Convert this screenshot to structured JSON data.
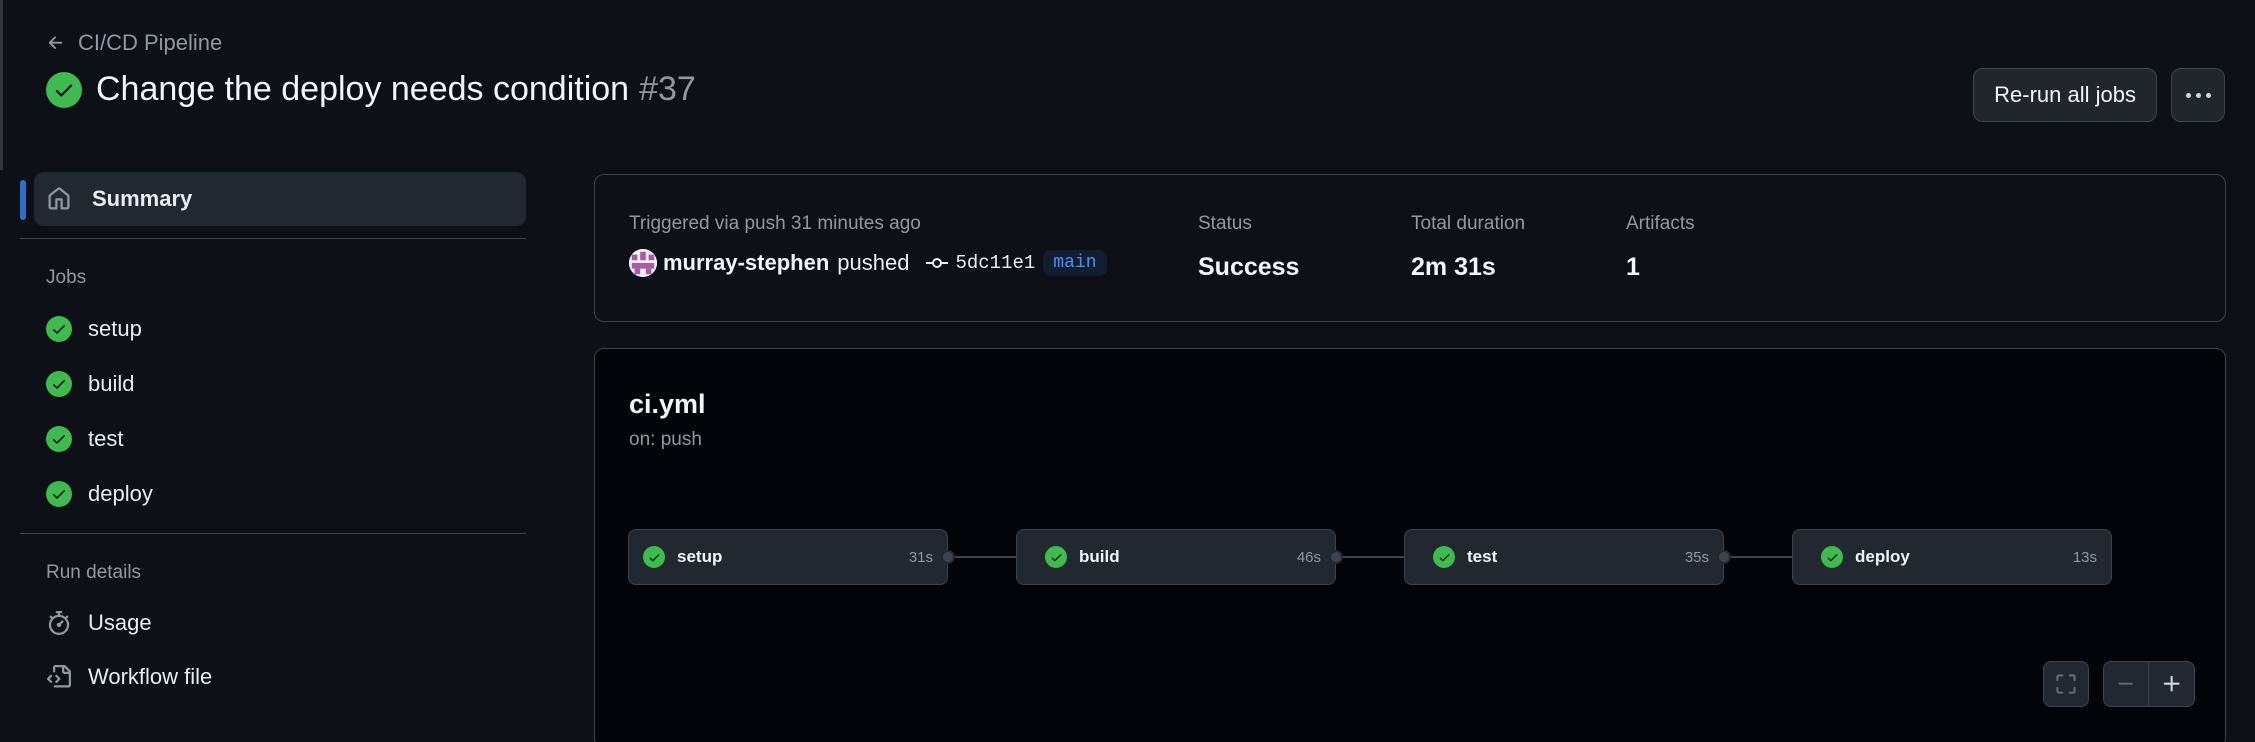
{
  "header": {
    "back_label": "CI/CD Pipeline",
    "title": "Change the deploy needs condition",
    "run_number": "#37",
    "rerun_label": "Re-run all jobs"
  },
  "sidebar": {
    "summary_label": "Summary",
    "jobs_heading": "Jobs",
    "jobs": [
      "setup",
      "build",
      "test",
      "deploy"
    ],
    "run_details_heading": "Run details",
    "details": [
      "Usage",
      "Workflow file"
    ]
  },
  "summary": {
    "triggered_text": "Triggered via push 31 minutes ago",
    "username": "murray-stephen",
    "action": "pushed",
    "commit_sha": "5dc11e1",
    "branch": "main",
    "status_label": "Status",
    "status_value": "Success",
    "duration_label": "Total duration",
    "duration_value": "2m 31s",
    "artifacts_label": "Artifacts",
    "artifacts_value": "1"
  },
  "workflow": {
    "file": "ci.yml",
    "trigger": "on: push",
    "nodes": [
      {
        "name": "setup",
        "duration": "31s"
      },
      {
        "name": "build",
        "duration": "46s"
      },
      {
        "name": "test",
        "duration": "35s"
      },
      {
        "name": "deploy",
        "duration": "13s"
      }
    ]
  },
  "colors": {
    "success": "#3fb950",
    "accent": "#4493f8",
    "background": "#0d1117"
  },
  "icons": {
    "back": "arrow-left-icon",
    "status": "check-circle-icon",
    "more": "kebab-horizontal-icon",
    "summary": "home-icon",
    "usage": "stopwatch-icon",
    "workflow_file": "file-code-icon",
    "commit": "git-commit-icon",
    "fullscreen": "screen-full-icon",
    "zoom_out": "dash-icon",
    "zoom_in": "plus-icon"
  }
}
